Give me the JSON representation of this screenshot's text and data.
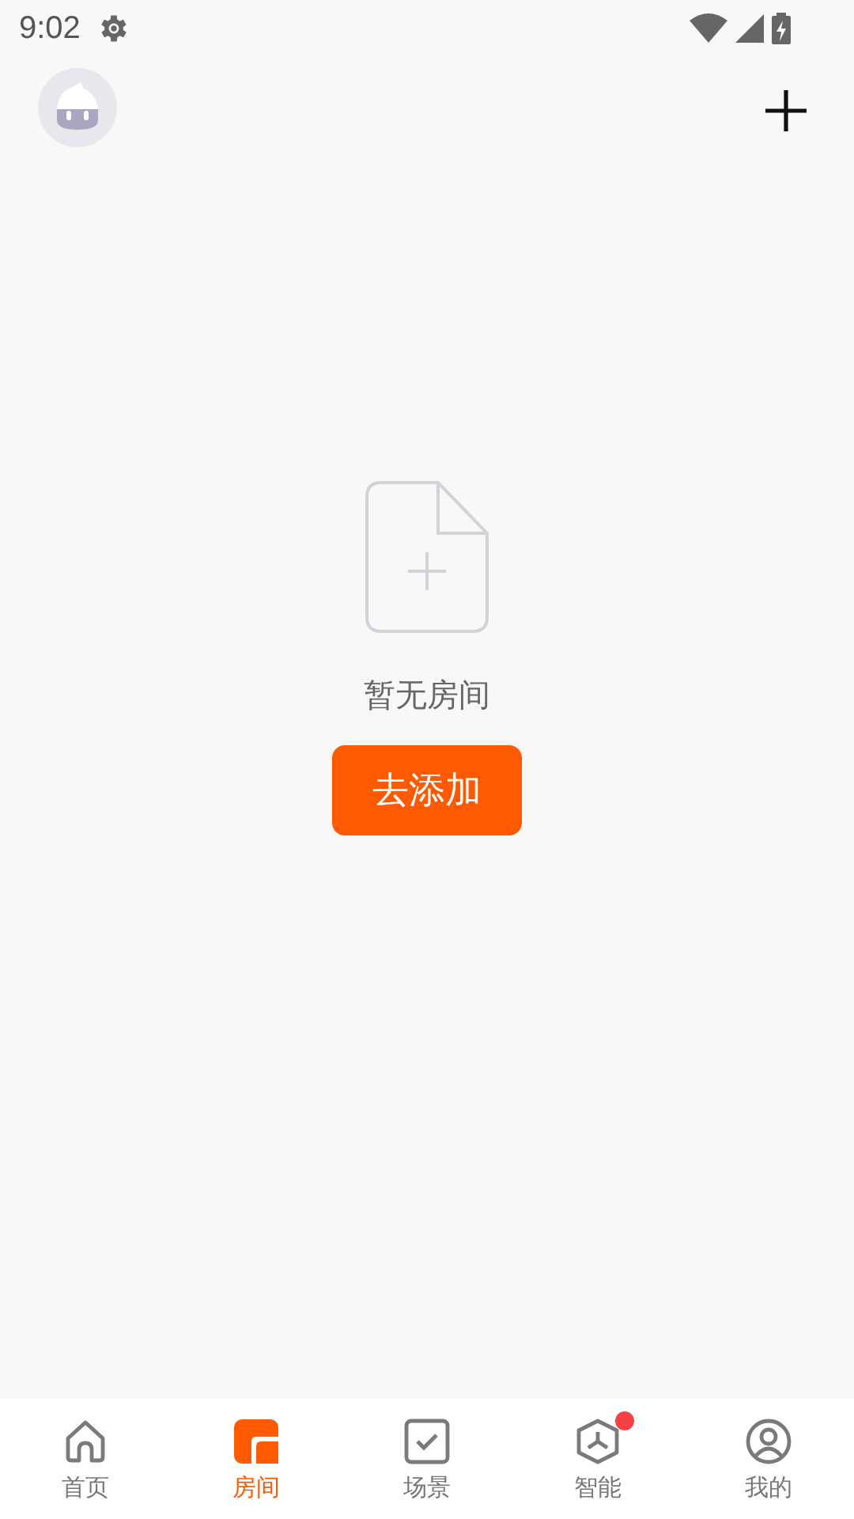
{
  "status_bar": {
    "time": "9:02"
  },
  "empty_state": {
    "message": "暂无房间",
    "action": "去添加"
  },
  "tabs": [
    {
      "label": "首页",
      "kind": "home",
      "selected": false,
      "badge": false
    },
    {
      "label": "房间",
      "kind": "room",
      "selected": true,
      "badge": false
    },
    {
      "label": "场景",
      "kind": "scene",
      "selected": false,
      "badge": false
    },
    {
      "label": "智能",
      "kind": "smart",
      "selected": false,
      "badge": true
    },
    {
      "label": "我的",
      "kind": "me",
      "selected": false,
      "badge": false
    }
  ]
}
